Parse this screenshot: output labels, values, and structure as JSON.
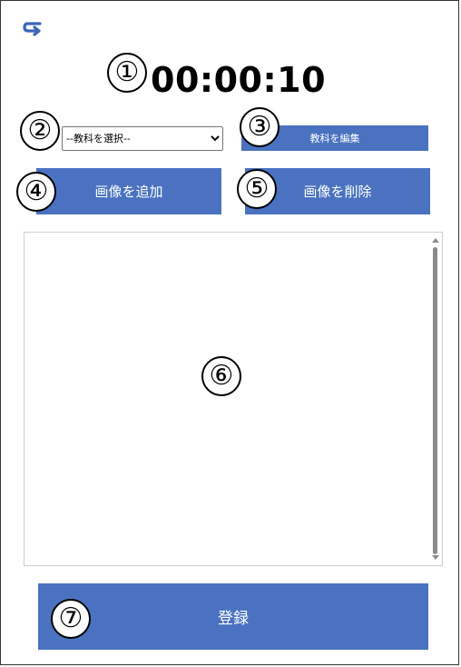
{
  "toolbar": {
    "back_icon": "return-arrow-icon",
    "back_color": "#3b66b5"
  },
  "timer": {
    "value": "00:00:10"
  },
  "subject": {
    "selected": "--教科を選択--",
    "options": [
      "--教科を選択--"
    ],
    "edit_label": "教科を編集"
  },
  "actions": {
    "add_image": "画像を追加",
    "delete_image": "画像を削除"
  },
  "register": {
    "label": "登録"
  },
  "markers": [
    "①",
    "②",
    "③",
    "④",
    "⑤",
    "⑥",
    "⑦"
  ],
  "colors": {
    "button": "#4a72c0",
    "button_text": "#ffffff"
  }
}
